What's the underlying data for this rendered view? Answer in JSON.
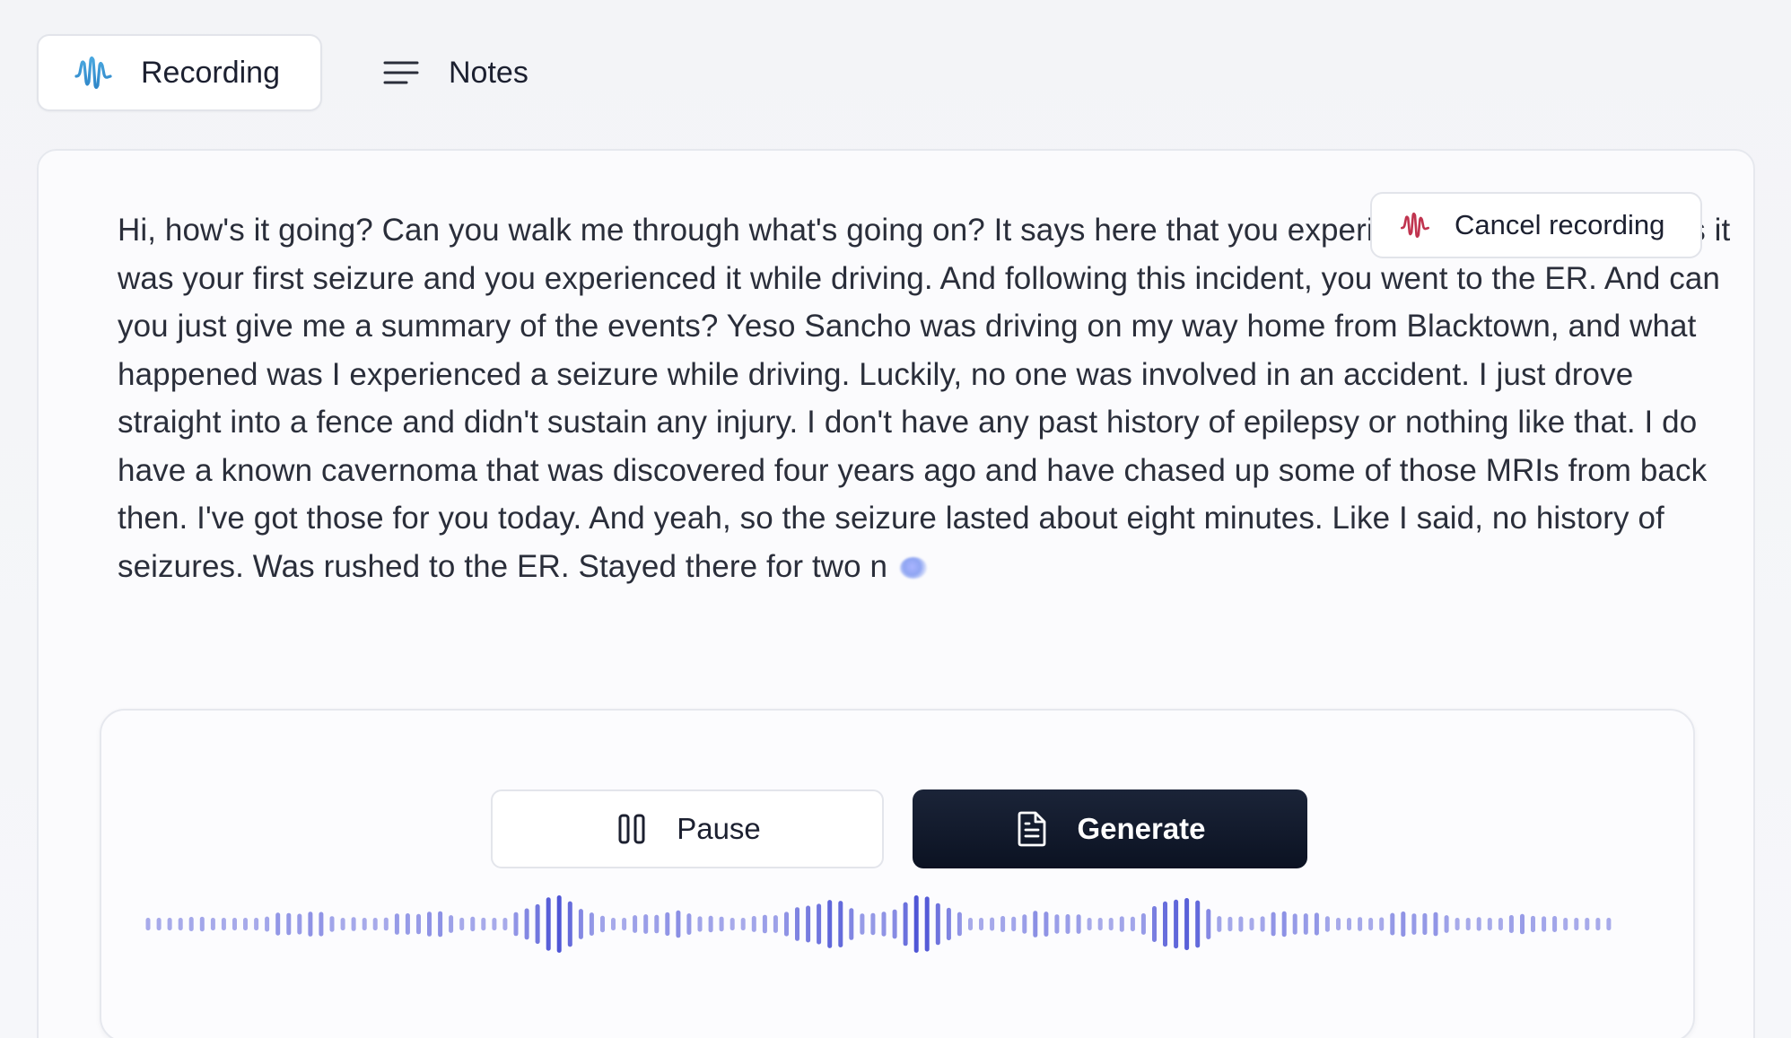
{
  "tabs": [
    {
      "label": "Recording",
      "icon": "waveform-icon",
      "active": true
    },
    {
      "label": "Notes",
      "icon": "menu-lines-icon",
      "active": false
    }
  ],
  "transcript": {
    "text": "Hi, how's it going? Can you walk me through what's going on? It says here that you experienced a seizure. It says it was your first seizure and you experienced it while driving. And following this incident, you went to the ER. And can you just give me a summary of the events? Yeso Sancho was driving on my way home from Blacktown, and what happened was I experienced a seizure while driving. Luckily, no one was involved in an accident. I just drove straight into a fence and didn't sustain any injury. I don't have any past history of epilepsy or nothing like that. I do have a known cavernoma that was discovered four years ago and have chased up some of those MRIs from back then. I've got those for you today. And yeah, so the seizure lasted about eight minutes. Like I said, no history of seizures. Was rushed to the ER. Stayed there for two n"
  },
  "cancel_button": {
    "label": "Cancel recording",
    "icon": "waveform-icon",
    "icon_color": "#c0344f"
  },
  "controls": {
    "pause_label": "Pause",
    "generate_label": "Generate"
  },
  "colors": {
    "accent_blue": "#3b9ad9",
    "wave_dark": "#4f56d6",
    "wave_light": "#b8bdf0",
    "generate_bg": "#0f1626"
  }
}
